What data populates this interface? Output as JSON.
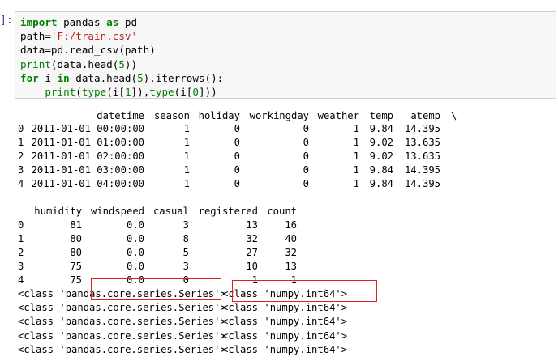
{
  "input": {
    "prompt": "]:",
    "code": [
      [
        {
          "t": "import",
          "c": "kw"
        },
        {
          "t": " pandas "
        },
        {
          "t": "as",
          "c": "kw"
        },
        {
          "t": " pd"
        }
      ],
      [
        {
          "t": "path="
        },
        {
          "t": "'F:/train.csv'",
          "c": "str"
        }
      ],
      [
        {
          "t": "data=pd.read_csv(path)"
        }
      ],
      [
        {
          "t": "print",
          "c": "builtin"
        },
        {
          "t": "(data.head("
        },
        {
          "t": "5",
          "c": "num"
        },
        {
          "t": "))"
        }
      ],
      [
        {
          "t": "for",
          "c": "kw"
        },
        {
          "t": " i "
        },
        {
          "t": "in",
          "c": "kw"
        },
        {
          "t": " data.head("
        },
        {
          "t": "5",
          "c": "num"
        },
        {
          "t": ").iterrows():"
        }
      ],
      [
        {
          "t": "    "
        },
        {
          "t": "print",
          "c": "builtin"
        },
        {
          "t": "("
        },
        {
          "t": "type",
          "c": "builtin"
        },
        {
          "t": "(i["
        },
        {
          "t": "1",
          "c": "num"
        },
        {
          "t": "]),"
        },
        {
          "t": "type",
          "c": "builtin"
        },
        {
          "t": "(i["
        },
        {
          "t": "0",
          "c": "num"
        },
        {
          "t": "]))"
        }
      ]
    ]
  },
  "table1": {
    "columns": [
      "datetime",
      "season",
      "holiday",
      "workingday",
      "weather",
      "temp",
      "atemp",
      "\\"
    ],
    "rows": [
      [
        "0",
        "2011-01-01 00:00:00",
        "1",
        "0",
        "0",
        "1",
        "9.84",
        "14.395"
      ],
      [
        "1",
        "2011-01-01 01:00:00",
        "1",
        "0",
        "0",
        "1",
        "9.02",
        "13.635"
      ],
      [
        "2",
        "2011-01-01 02:00:00",
        "1",
        "0",
        "0",
        "1",
        "9.02",
        "13.635"
      ],
      [
        "3",
        "2011-01-01 03:00:00",
        "1",
        "0",
        "0",
        "1",
        "9.84",
        "14.395"
      ],
      [
        "4",
        "2011-01-01 04:00:00",
        "1",
        "0",
        "0",
        "1",
        "9.84",
        "14.395"
      ]
    ]
  },
  "table2": {
    "columns": [
      "humidity",
      "windspeed",
      "casual",
      "registered",
      "count"
    ],
    "rows": [
      [
        "0",
        "81",
        "0.0",
        "3",
        "13",
        "16"
      ],
      [
        "1",
        "80",
        "0.0",
        "8",
        "32",
        "40"
      ],
      [
        "2",
        "80",
        "0.0",
        "5",
        "27",
        "32"
      ],
      [
        "3",
        "75",
        "0.0",
        "3",
        "10",
        "13"
      ],
      [
        "4",
        "75",
        "0.0",
        "0",
        "1",
        "1"
      ]
    ]
  },
  "type_lines": [
    [
      "<class 'pandas.core.series.Series'>",
      "<class 'numpy.int64'>"
    ],
    [
      "<class 'pandas.core.series.Series'>",
      "<class 'numpy.int64'>"
    ],
    [
      "<class 'pandas.core.series.Series'>",
      "<class 'numpy.int64'>"
    ],
    [
      "<class 'pandas.core.series.Series'>",
      "<class 'numpy.int64'>"
    ],
    [
      "<class 'pandas.core.series.Series'>",
      "<class 'numpy.int64'>"
    ]
  ],
  "colors": {
    "highlight_box": "#e0201c",
    "input_background": "#f7f7f7",
    "keyword": "#008000",
    "string": "#ba2121"
  }
}
